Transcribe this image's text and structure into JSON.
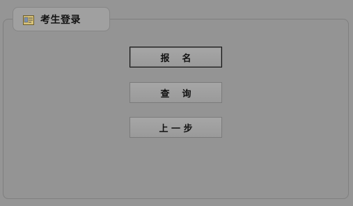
{
  "panel": {
    "title": "考生登录",
    "icon": "id-card-icon"
  },
  "buttons": [
    {
      "label": "报    名",
      "state": "focused"
    },
    {
      "label": "查    询",
      "state": "normal"
    },
    {
      "label": "上 一 步",
      "state": "normal"
    }
  ],
  "colors": {
    "background": "#959595",
    "button_border_focus": "#111111",
    "button_border": "#7b7b7b"
  }
}
